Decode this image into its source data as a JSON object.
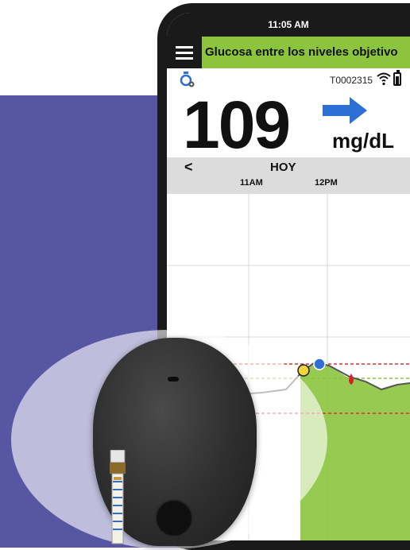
{
  "phone": {
    "status_bar": {
      "time": "11:05 AM"
    },
    "alert_bar": {
      "text": "Glucosa entre los niveles objetivo",
      "color": "#8cc43e"
    },
    "info_row": {
      "transmitter_id": "T0002315",
      "icons": [
        "sensor-settings-icon",
        "wifi-signal-icon",
        "battery-icon"
      ]
    },
    "glucose": {
      "value": "109",
      "units": "mg/dL",
      "trend_icon": "trend-arrow-right-icon",
      "trend_color": "#2e6fd6"
    },
    "chart": {
      "back_label": "<",
      "day_label": "HOY",
      "time_labels": [
        "11AM",
        "12PM"
      ],
      "target_color": "#8cc43e",
      "high_line_color": "#e03131",
      "low_line_color": "#e03131"
    }
  },
  "device": {
    "name": "pod",
    "icons": [
      "pod-device-icon",
      "sensor-filament-icon"
    ]
  }
}
